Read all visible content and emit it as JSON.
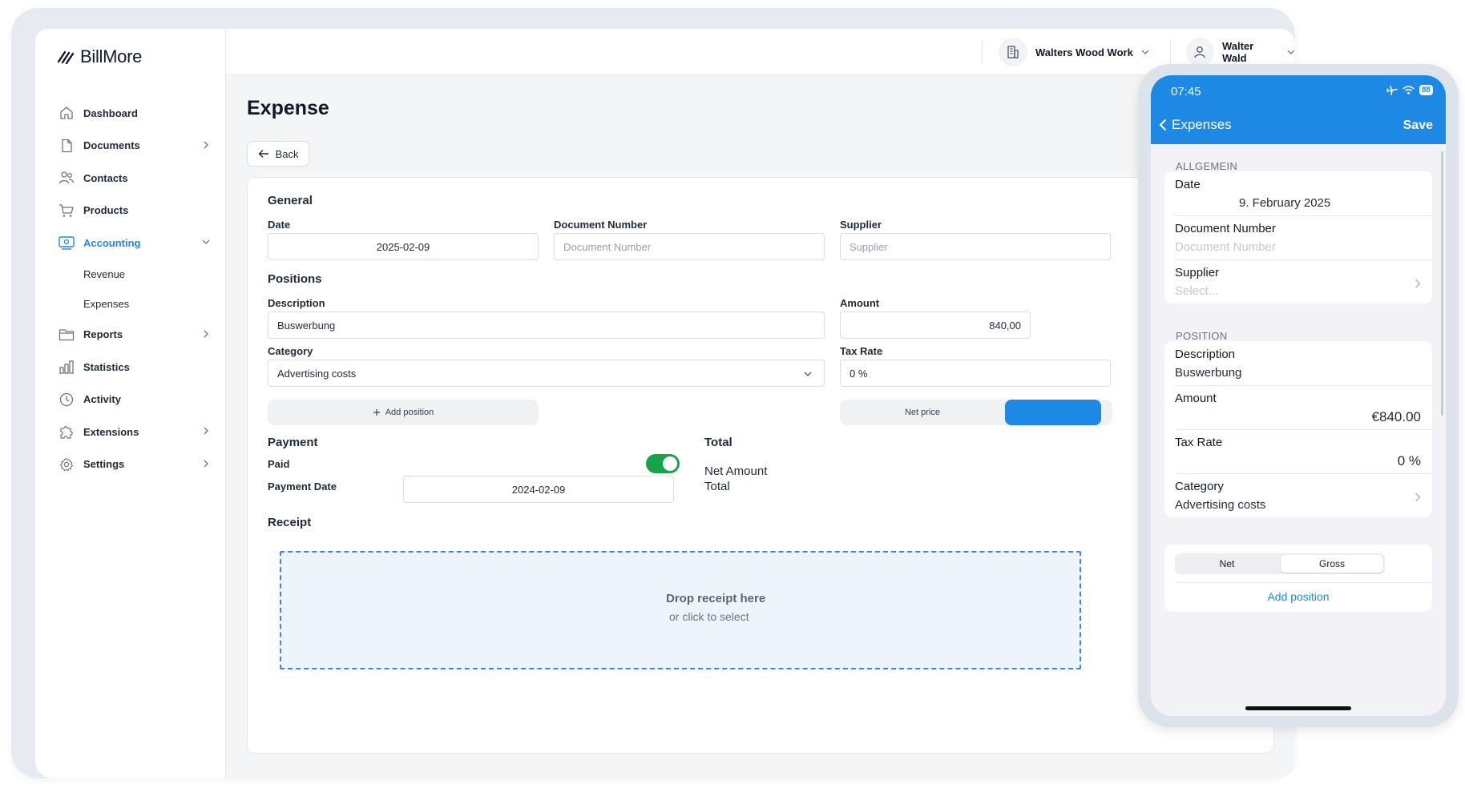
{
  "app": {
    "brand": "BillMore",
    "accent": "#1e88e5"
  },
  "sidebar": {
    "items": [
      {
        "label": "Dashboard",
        "icon": "home-icon"
      },
      {
        "label": "Documents",
        "icon": "document-icon"
      },
      {
        "label": "Contacts",
        "icon": "contacts-icon"
      },
      {
        "label": "Products",
        "icon": "cart-icon"
      },
      {
        "label": "Accounting",
        "icon": "accounting-icon"
      },
      {
        "label": "Revenue"
      },
      {
        "label": "Expenses"
      },
      {
        "label": "Reports",
        "icon": "folder-icon"
      },
      {
        "label": "Statistics",
        "icon": "bar-chart-icon"
      },
      {
        "label": "Activity",
        "icon": "clock-icon"
      },
      {
        "label": "Extensions",
        "icon": "puzzle-icon"
      },
      {
        "label": "Settings",
        "icon": "gear-icon"
      }
    ]
  },
  "topbar": {
    "organization": "Walters Wood Work",
    "user": "Walter Wald"
  },
  "page": {
    "title": "Expense",
    "back_label": "Back"
  },
  "general": {
    "heading": "General",
    "date_label": "Date",
    "date_value": "2025-02-09",
    "doc_number_label": "Document Number",
    "doc_number_placeholder": "Document Number",
    "supplier_label": "Supplier",
    "supplier_placeholder": "Supplier"
  },
  "positions": {
    "heading": "Positions",
    "description_label": "Description",
    "description_value": "Buswerbung",
    "amount_label": "Amount",
    "amount_value": "840,00",
    "category_label": "Category",
    "category_value": "Advertising costs",
    "tax_label": "Tax Rate",
    "tax_value": "0 %",
    "add_position": "Add position",
    "net_price": "Net price"
  },
  "payment": {
    "heading": "Payment",
    "paid_label": "Paid",
    "paid": true,
    "date_label": "Payment Date",
    "date_value": "2024-02-09"
  },
  "total": {
    "heading": "Total",
    "net_amount_label": "Net Amount",
    "total_label": "Total"
  },
  "receipt": {
    "heading": "Receipt",
    "drop_title": "Drop receipt here",
    "drop_sub": "or click to select"
  },
  "mobile": {
    "time": "07:45",
    "battery": "88",
    "back_label": "Expenses",
    "save_label": "Save",
    "general_heading": "ALLGEMEIN",
    "date_label": "Date",
    "date_value": "9. February 2025",
    "doc_number_label": "Document Number",
    "doc_number_placeholder": "Document Number",
    "supplier_label": "Supplier",
    "supplier_placeholder": "Select...",
    "position_heading": "POSITION",
    "description_label": "Description",
    "description_value": "Buswerbung",
    "amount_label": "Amount",
    "amount_value": "€840.00",
    "tax_label": "Tax Rate",
    "tax_value": "0 %",
    "category_label": "Category",
    "category_value": "Advertising costs",
    "net_label": "Net",
    "gross_label": "Gross",
    "add_position": "Add position"
  }
}
